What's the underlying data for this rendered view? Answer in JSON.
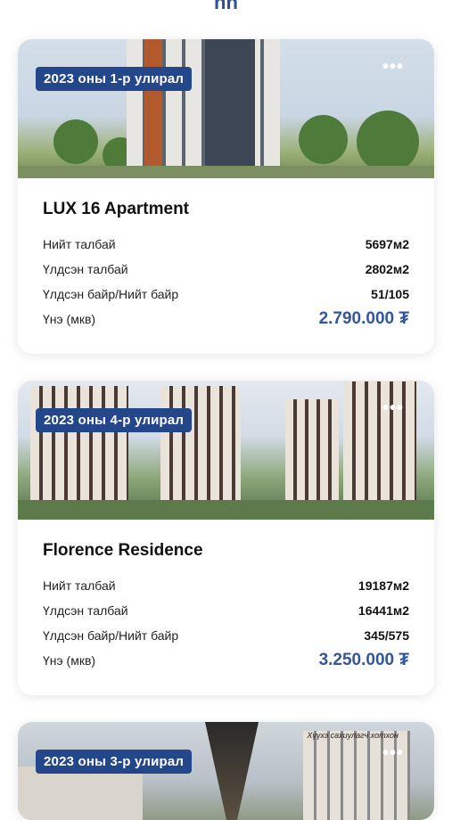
{
  "header": {
    "fragment": "nn"
  },
  "cards": [
    {
      "badge": "2023 оны 1-р улирал",
      "title": "LUX 16 Apartment",
      "rows": [
        {
          "label": "Нийт талбай",
          "value": "5697м2"
        },
        {
          "label": "Үлдсэн талбай",
          "value": "2802м2"
        },
        {
          "label": "Үлдсэн байр/Нийт байр",
          "value": "51/105"
        }
      ],
      "price": {
        "label": "Үнэ (мкв)",
        "value": "2.790.000 ₮"
      }
    },
    {
      "badge": "2023 оны 4-р улирал",
      "title": "Florence Residence",
      "rows": [
        {
          "label": "Нийт талбай",
          "value": "19187м2"
        },
        {
          "label": "Үлдсэн талбай",
          "value": "16441м2"
        },
        {
          "label": "Үлдсэн байр/Нийт байр",
          "value": "345/575"
        }
      ],
      "price": {
        "label": "Үнэ (мкв)",
        "value": "3.250.000 ₮"
      }
    },
    {
      "badge": "2023 оны 3-р улирал",
      "watermark": "Хүүхэ сахиулагч хотхон"
    }
  ],
  "icons": {
    "more": "more-dots-icon"
  },
  "colors": {
    "badge": "#24478c",
    "price": "#33579b"
  }
}
